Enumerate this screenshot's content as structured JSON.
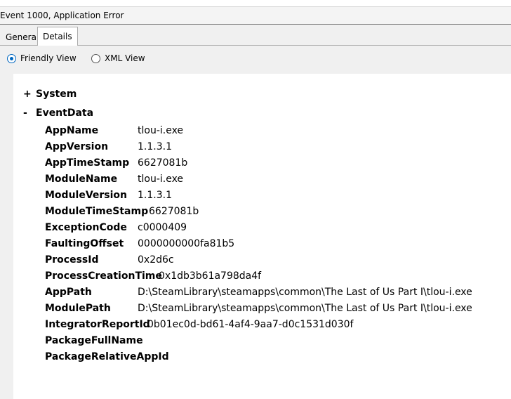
{
  "window": {
    "title": "Event 1000, Application Error"
  },
  "tabs": [
    {
      "label": "General",
      "active": false
    },
    {
      "label": "Details",
      "active": true
    }
  ],
  "view_options": {
    "friendly": {
      "label": "Friendly View",
      "checked": true
    },
    "xml": {
      "label": "XML View",
      "checked": false
    }
  },
  "tree": {
    "system": {
      "toggle": "+",
      "label": "System"
    },
    "event_data": {
      "toggle": "-",
      "label": "EventData",
      "rows": [
        {
          "key": "AppName",
          "value": "tlou-i.exe"
        },
        {
          "key": "AppVersion",
          "value": "1.1.3.1"
        },
        {
          "key": "AppTimeStamp",
          "value": "6627081b"
        },
        {
          "key": "ModuleName",
          "value": "tlou-i.exe"
        },
        {
          "key": "ModuleVersion",
          "value": "1.1.3.1"
        },
        {
          "key": "ModuleTimeStamp",
          "value": "6627081b"
        },
        {
          "key": "ExceptionCode",
          "value": "c0000409"
        },
        {
          "key": "FaultingOffset",
          "value": "0000000000fa81b5"
        },
        {
          "key": "ProcessId",
          "value": "0x2d6c"
        },
        {
          "key": "ProcessCreationTime",
          "value": "0x1db3b61a798da4f"
        },
        {
          "key": "AppPath",
          "value": "D:\\SteamLibrary\\steamapps\\common\\The Last of Us Part I\\tlou-i.exe"
        },
        {
          "key": "ModulePath",
          "value": "D:\\SteamLibrary\\steamapps\\common\\The Last of Us Part I\\tlou-i.exe"
        },
        {
          "key": "IntegratorReportId",
          "value": "0b01ec0d-bd61-4af4-9aa7-d0c1531d030f"
        },
        {
          "key": "PackageFullName",
          "value": ""
        },
        {
          "key": "PackageRelativeAppId",
          "value": ""
        }
      ]
    }
  },
  "colors": {
    "accent": "#0067c0",
    "chrome": "#f0f0f0",
    "divider": "#adadad"
  }
}
